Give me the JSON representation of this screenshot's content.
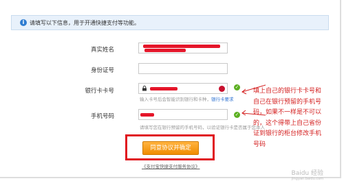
{
  "notice": {
    "text": "请填写以下信息，用于开通快捷支付等功能。"
  },
  "form": {
    "name_label": "真实姓名",
    "id_label": "身份证号",
    "card_label": "银行卡卡号",
    "card_hint": "输入卡号后会智能识别银行和卡种，",
    "card_hint_link": "银行卡要求",
    "phone_label": "手机号码",
    "phone_hint": "请填写您在银行预留的手机号码，以验证银行卡是否属于您本人"
  },
  "submit": {
    "label": "同意协议并确定"
  },
  "agreement": {
    "text": "《支付宝快捷支付服务协议》"
  },
  "annotation": {
    "text": "填上自己的银行卡卡号和自己在银行预留的手机号码，如果不一样是不可以的，这个得带上自己省份证到银行的柜台修改手机号码"
  },
  "watermark": {
    "text": "Baidu 经验",
    "sub": "jingyan.baidu.com"
  },
  "colors": {
    "accent": "#f08c00",
    "annotation": "#d42020",
    "redact": "#e5162a"
  }
}
